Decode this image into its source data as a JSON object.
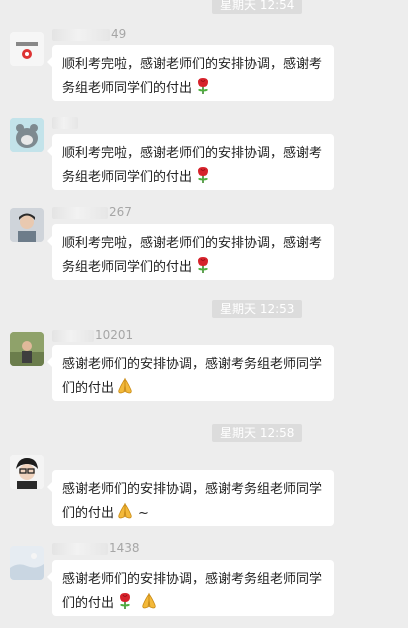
{
  "timestamps": [
    "星期天 12:54",
    "星期天 12:53",
    "星期天 12:58"
  ],
  "messages": [
    {
      "id_suffix": "49",
      "text": "顺利考完啦，感谢老师们的安排协调，感谢考务组老师同学们的付出",
      "emojis": [
        "rose-emoji"
      ]
    },
    {
      "id_suffix": "",
      "text": "顺利考完啦，感谢老师们的安排协调，感谢考务组老师同学们的付出",
      "emojis": [
        "rose-emoji"
      ]
    },
    {
      "id_suffix": "267",
      "text": "顺利考完啦，感谢老师们的安排协调，感谢考务组老师同学们的付出",
      "emojis": [
        "rose-emoji"
      ]
    },
    {
      "id_suffix": "10201",
      "text": "感谢老师们的安排协调，感谢考务组老师同学们的付出",
      "emojis": [
        "pray-emoji"
      ]
    },
    {
      "id_suffix": "",
      "text": "感谢老师们的安排协调，感谢考务组老师同学们的付出",
      "emojis": [
        "pray-emoji"
      ],
      "trailing": "~"
    },
    {
      "id_suffix": "1438",
      "text": "感谢老师们的安排协调，感谢考务组老师同学们的付出",
      "emojis": [
        "rose-emoji",
        "pray-emoji"
      ]
    }
  ],
  "colors": {
    "background": "#ededed",
    "bubble": "#ffffff",
    "timestamp_bg": "#dcdcdc"
  }
}
